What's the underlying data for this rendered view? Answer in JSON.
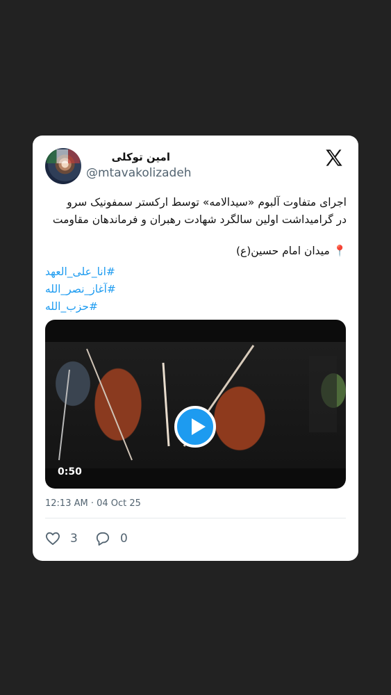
{
  "tweet": {
    "author_name": "امین توکلی",
    "handle": "@mtavakolizadeh",
    "text_line1": "اجرای متفاوت آلبوم «سیدالامه» توسط ارکستر سمفونیک سرو",
    "text_line2": "در گرامیداشت اولین سالگرد شهادت رهبران و فرماندهان مقاومت",
    "location": "📍 میدان امام حسین(ع)",
    "hashtags": [
      "#انا_علی_العهد",
      "#آغاز_نصر_الله",
      "#حزب_الله"
    ],
    "video_duration": "0:50",
    "timestamp": "12:13 AM · 04 Oct 25",
    "likes": "3",
    "replies": "0"
  },
  "icons": {
    "platform": "x-logo-icon",
    "play": "play-icon",
    "like": "heart-icon",
    "reply": "comment-icon"
  },
  "colors": {
    "background": "#222222",
    "card": "#ffffff",
    "accent": "#1d9bf0",
    "muted": "#536471"
  }
}
